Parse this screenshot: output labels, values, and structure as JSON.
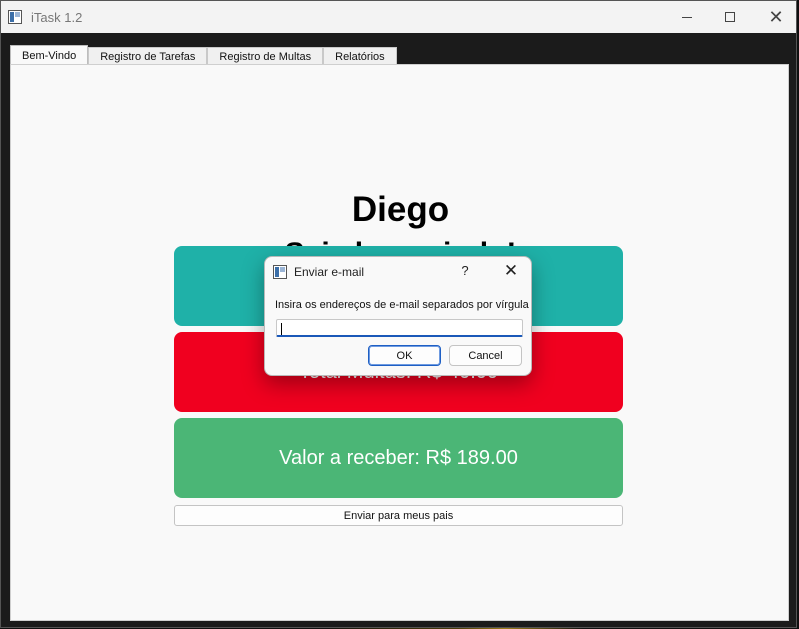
{
  "window": {
    "title": "iTask 1.2",
    "minimize_icon": "minimize-icon",
    "maximize_icon": "maximize-icon",
    "close_glyph": "✕"
  },
  "tabs": [
    {
      "label": "Bem-Vindo",
      "active": true
    },
    {
      "label": "Registro de Tarefas",
      "active": false
    },
    {
      "label": "Registro de Multas",
      "active": false
    },
    {
      "label": "Relatórios",
      "active": false
    }
  ],
  "welcome": {
    "name": "Diego",
    "message": "Seja bem-vindo!",
    "cards": {
      "fines": "Total Multas: R$ 40.00",
      "receive": "Valor a receber: R$ 189.00"
    },
    "send_button": "Enviar para meus pais"
  },
  "dialog": {
    "title": "Enviar e-mail",
    "help_glyph": "?",
    "close_glyph": "✕",
    "label": "Insira os endereços de e-mail separados por vírgula",
    "input_value": "",
    "ok_label": "OK",
    "cancel_label": "Cancel"
  },
  "colors": {
    "card_tasks": "#1fb1a8",
    "card_fines": "#f0001f",
    "card_receive": "#4bb676",
    "accent": "#1a58b8"
  }
}
